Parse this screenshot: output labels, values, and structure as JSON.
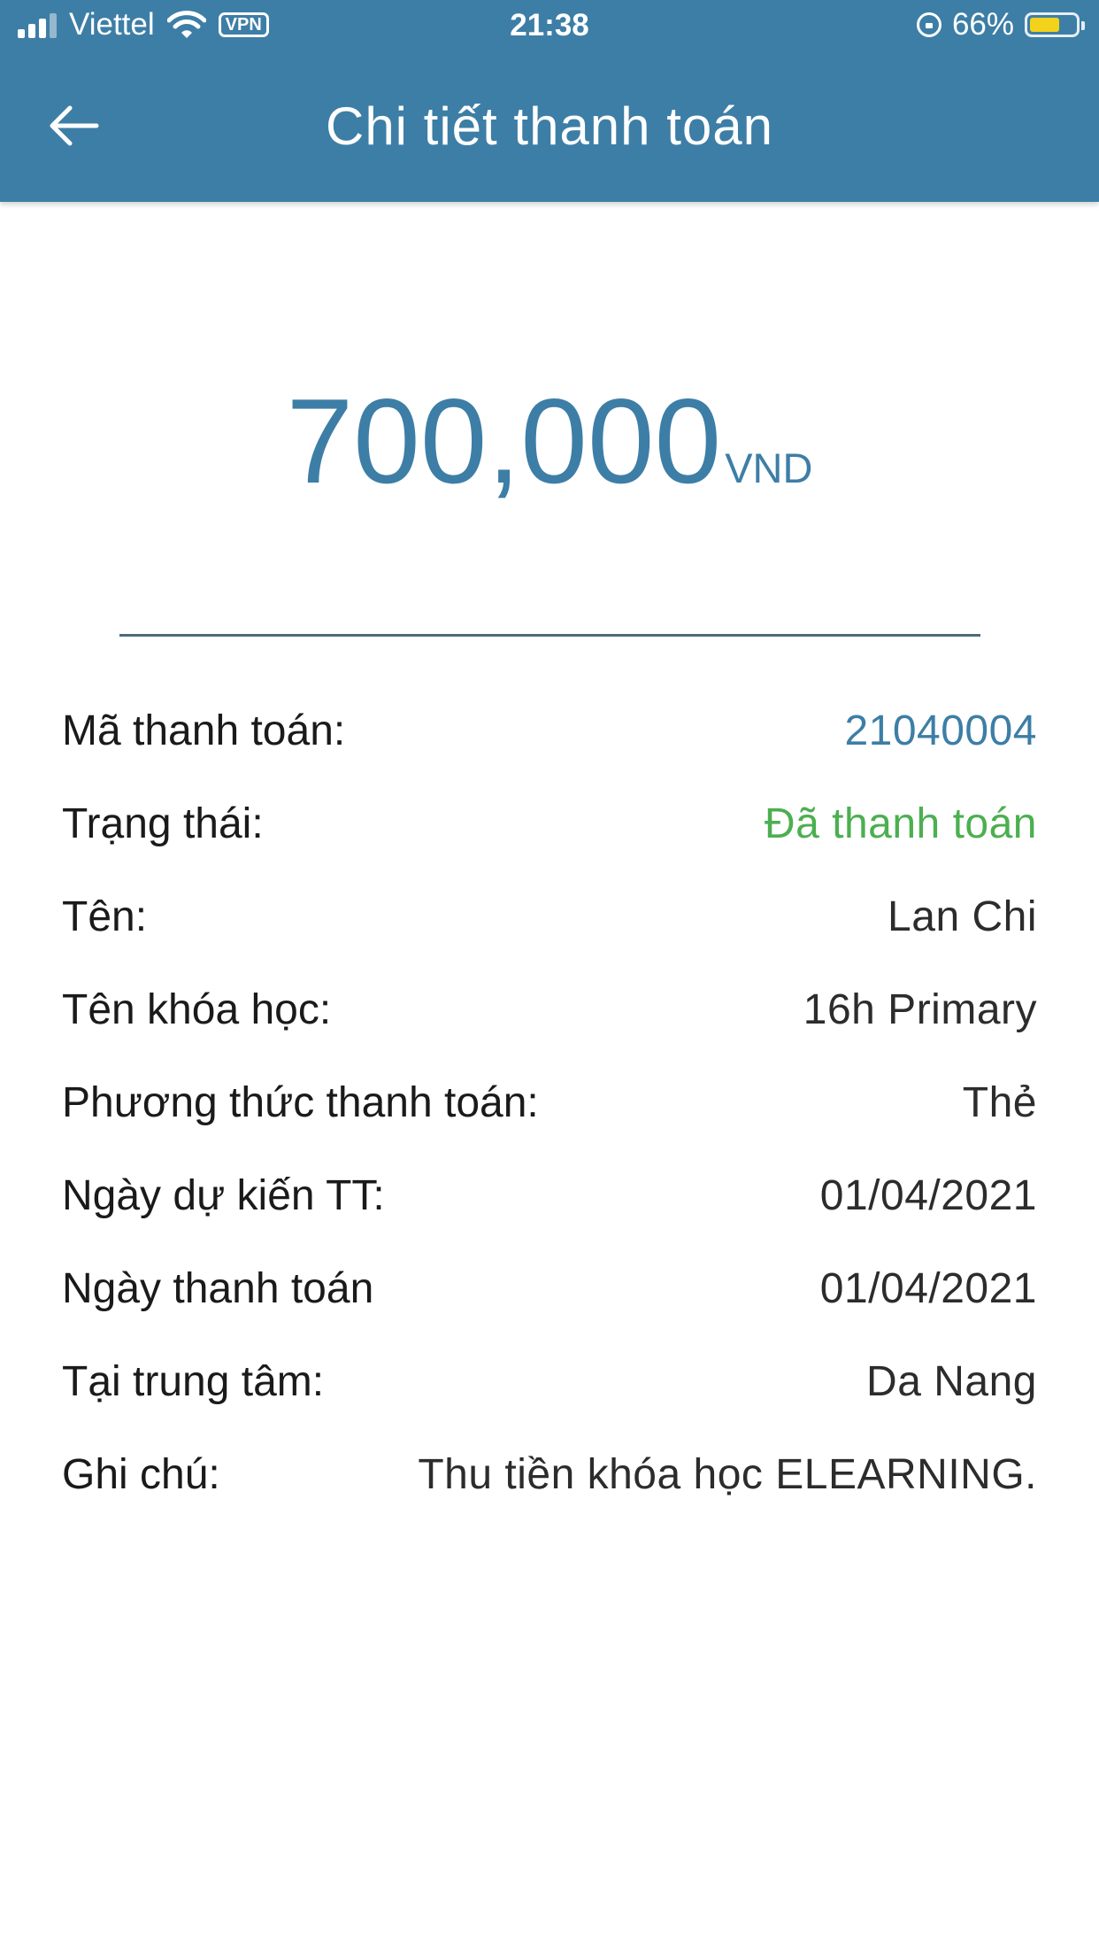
{
  "status_bar": {
    "carrier": "Viettel",
    "vpn": "VPN",
    "time": "21:38",
    "battery_percent": "66%",
    "battery_level": 0.66
  },
  "header": {
    "title": "Chi tiết thanh toán",
    "back_icon": "arrow-left-icon"
  },
  "amount": {
    "value": "700,000",
    "currency": "VND"
  },
  "details": [
    {
      "label": "Mã thanh toán:",
      "value": "21040004"
    },
    {
      "label": "Trạng thái:",
      "value": "Đã thanh toán"
    },
    {
      "label": "Tên:",
      "value": "Lan Chi"
    },
    {
      "label": "Tên khóa học:",
      "value": "16h Primary"
    },
    {
      "label": "Phương thức thanh toán:",
      "value": "Thẻ"
    },
    {
      "label": "Ngày dự kiến TT:",
      "value": "01/04/2021"
    },
    {
      "label": "Ngày thanh toán",
      "value": "01/04/2021"
    },
    {
      "label": "Tại trung tâm:",
      "value": "Da Nang"
    },
    {
      "label": "Ghi chú:",
      "value": "Thu tiền khóa học ELEARNING."
    }
  ],
  "colors": {
    "primary": "#3d7ea6",
    "paid_status": "#4caf50",
    "divider": "#4c6b7d"
  }
}
